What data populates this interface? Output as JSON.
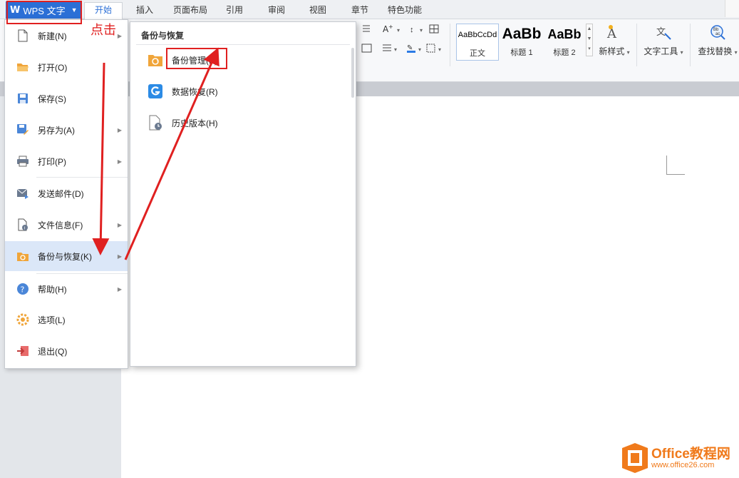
{
  "app": {
    "menu_button_label": "WPS 文字",
    "tabs": [
      "开始",
      "插入",
      "页面布局",
      "引用",
      "审阅",
      "视图",
      "章节",
      "特色功能"
    ],
    "active_tab": "开始"
  },
  "ribbon": {
    "styles": [
      {
        "sample": "AaBbCcDd",
        "label": "正文"
      },
      {
        "sample": "AaBb",
        "label": "标题 1"
      },
      {
        "sample": "AaBb",
        "label": "标题 2"
      }
    ],
    "new_style": "新样式",
    "text_tool": "文字工具",
    "find_replace": "查找替换"
  },
  "file_menu": {
    "items": [
      {
        "label": "新建(N)",
        "icon": "new-doc-icon",
        "has_submenu": true
      },
      {
        "label": "打开(O)",
        "icon": "open-folder-icon",
        "has_submenu": false
      },
      {
        "label": "保存(S)",
        "icon": "save-icon",
        "has_submenu": false
      },
      {
        "label": "另存为(A)",
        "icon": "save-as-icon",
        "has_submenu": true
      },
      {
        "label": "打印(P)",
        "icon": "print-icon",
        "has_submenu": true
      },
      {
        "label": "发送邮件(D)",
        "icon": "mail-icon",
        "has_submenu": false
      },
      {
        "label": "文件信息(F)",
        "icon": "file-info-icon",
        "has_submenu": true
      },
      {
        "label": "备份与恢复(K)",
        "icon": "backup-icon",
        "has_submenu": true,
        "selected": true
      },
      {
        "label": "帮助(H)",
        "icon": "help-icon",
        "has_submenu": true
      },
      {
        "label": "选项(L)",
        "icon": "gear-icon",
        "has_submenu": false
      },
      {
        "label": "退出(Q)",
        "icon": "exit-icon",
        "has_submenu": false
      }
    ]
  },
  "submenu": {
    "title": "备份与恢复",
    "items": [
      {
        "label": "备份管理(K)",
        "icon": "backup-folder-icon"
      },
      {
        "label": "数据恢复(R)",
        "icon": "data-recovery-icon"
      },
      {
        "label": "历史版本(H)",
        "icon": "history-version-icon"
      }
    ]
  },
  "annotation": {
    "text": "点击",
    "color": "#e02020"
  },
  "watermark": {
    "brand": "Office教程网",
    "url": "www.office26.com",
    "color": "#f07a1b"
  },
  "colors": {
    "accent": "#2b6fd6",
    "selected_bg": "#dbe7f8"
  }
}
